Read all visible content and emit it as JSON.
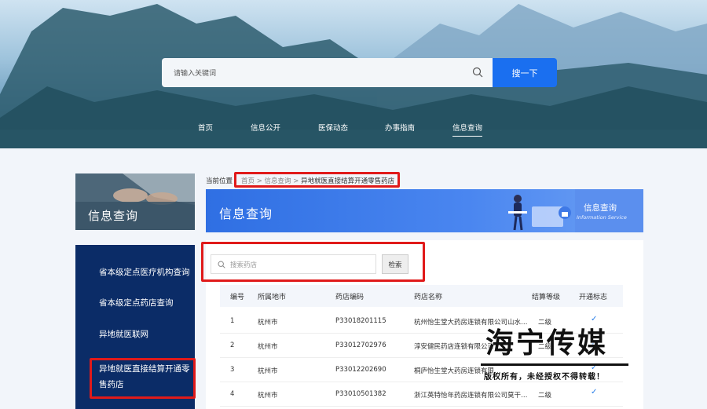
{
  "header": {
    "search_placeholder": "请输入关键词",
    "search_button": "搜一下",
    "nav": [
      "首页",
      "信息公开",
      "医保动态",
      "办事指南",
      "信息查询"
    ],
    "active_nav": "信息查询"
  },
  "sidebar": {
    "banner_title": "信息查询",
    "items": [
      {
        "label": "省本级定点医疗机构查询"
      },
      {
        "label": "省本级定点药店查询"
      },
      {
        "label": "异地就医联网"
      },
      {
        "label": "异地就医直接结算开通零售药店"
      }
    ]
  },
  "breadcrumb": {
    "prefix": "当前位置",
    "links": [
      "首页",
      "信息查询",
      "异地就医直接结算开通零售药店"
    ],
    "separator": ">"
  },
  "title_banner": {
    "title": "信息查询",
    "right_cn": "信息查询",
    "right_en": "Information Service"
  },
  "search": {
    "placeholder": "搜索药店",
    "button": "检索"
  },
  "table": {
    "columns": [
      "编号",
      "所属地市",
      "药店编码",
      "药店名称",
      "结算等级",
      "开通标志"
    ],
    "rows": [
      {
        "no": "1",
        "city": "杭州市",
        "code": "P33018201115",
        "name": "杭州怡生堂大药房连锁有限公司山水…",
        "level": "二级",
        "flag": "✓"
      },
      {
        "no": "2",
        "city": "杭州市",
        "code": "P33012702976",
        "name": "淳安健民药店连锁有限公司…",
        "level": "二级",
        "flag": "✓"
      },
      {
        "no": "3",
        "city": "杭州市",
        "code": "P33012202690",
        "name": "桐庐怡生堂大药房连锁有限…",
        "level": "",
        "flag": "✓"
      },
      {
        "no": "4",
        "city": "杭州市",
        "code": "P33010501382",
        "name": "浙江英特怡年药房连锁有限公司莫干…",
        "level": "二级",
        "flag": "✓"
      }
    ]
  },
  "watermark": {
    "title": "海宁传媒",
    "subtitle": "版权所有，未经授权不得转载！"
  }
}
